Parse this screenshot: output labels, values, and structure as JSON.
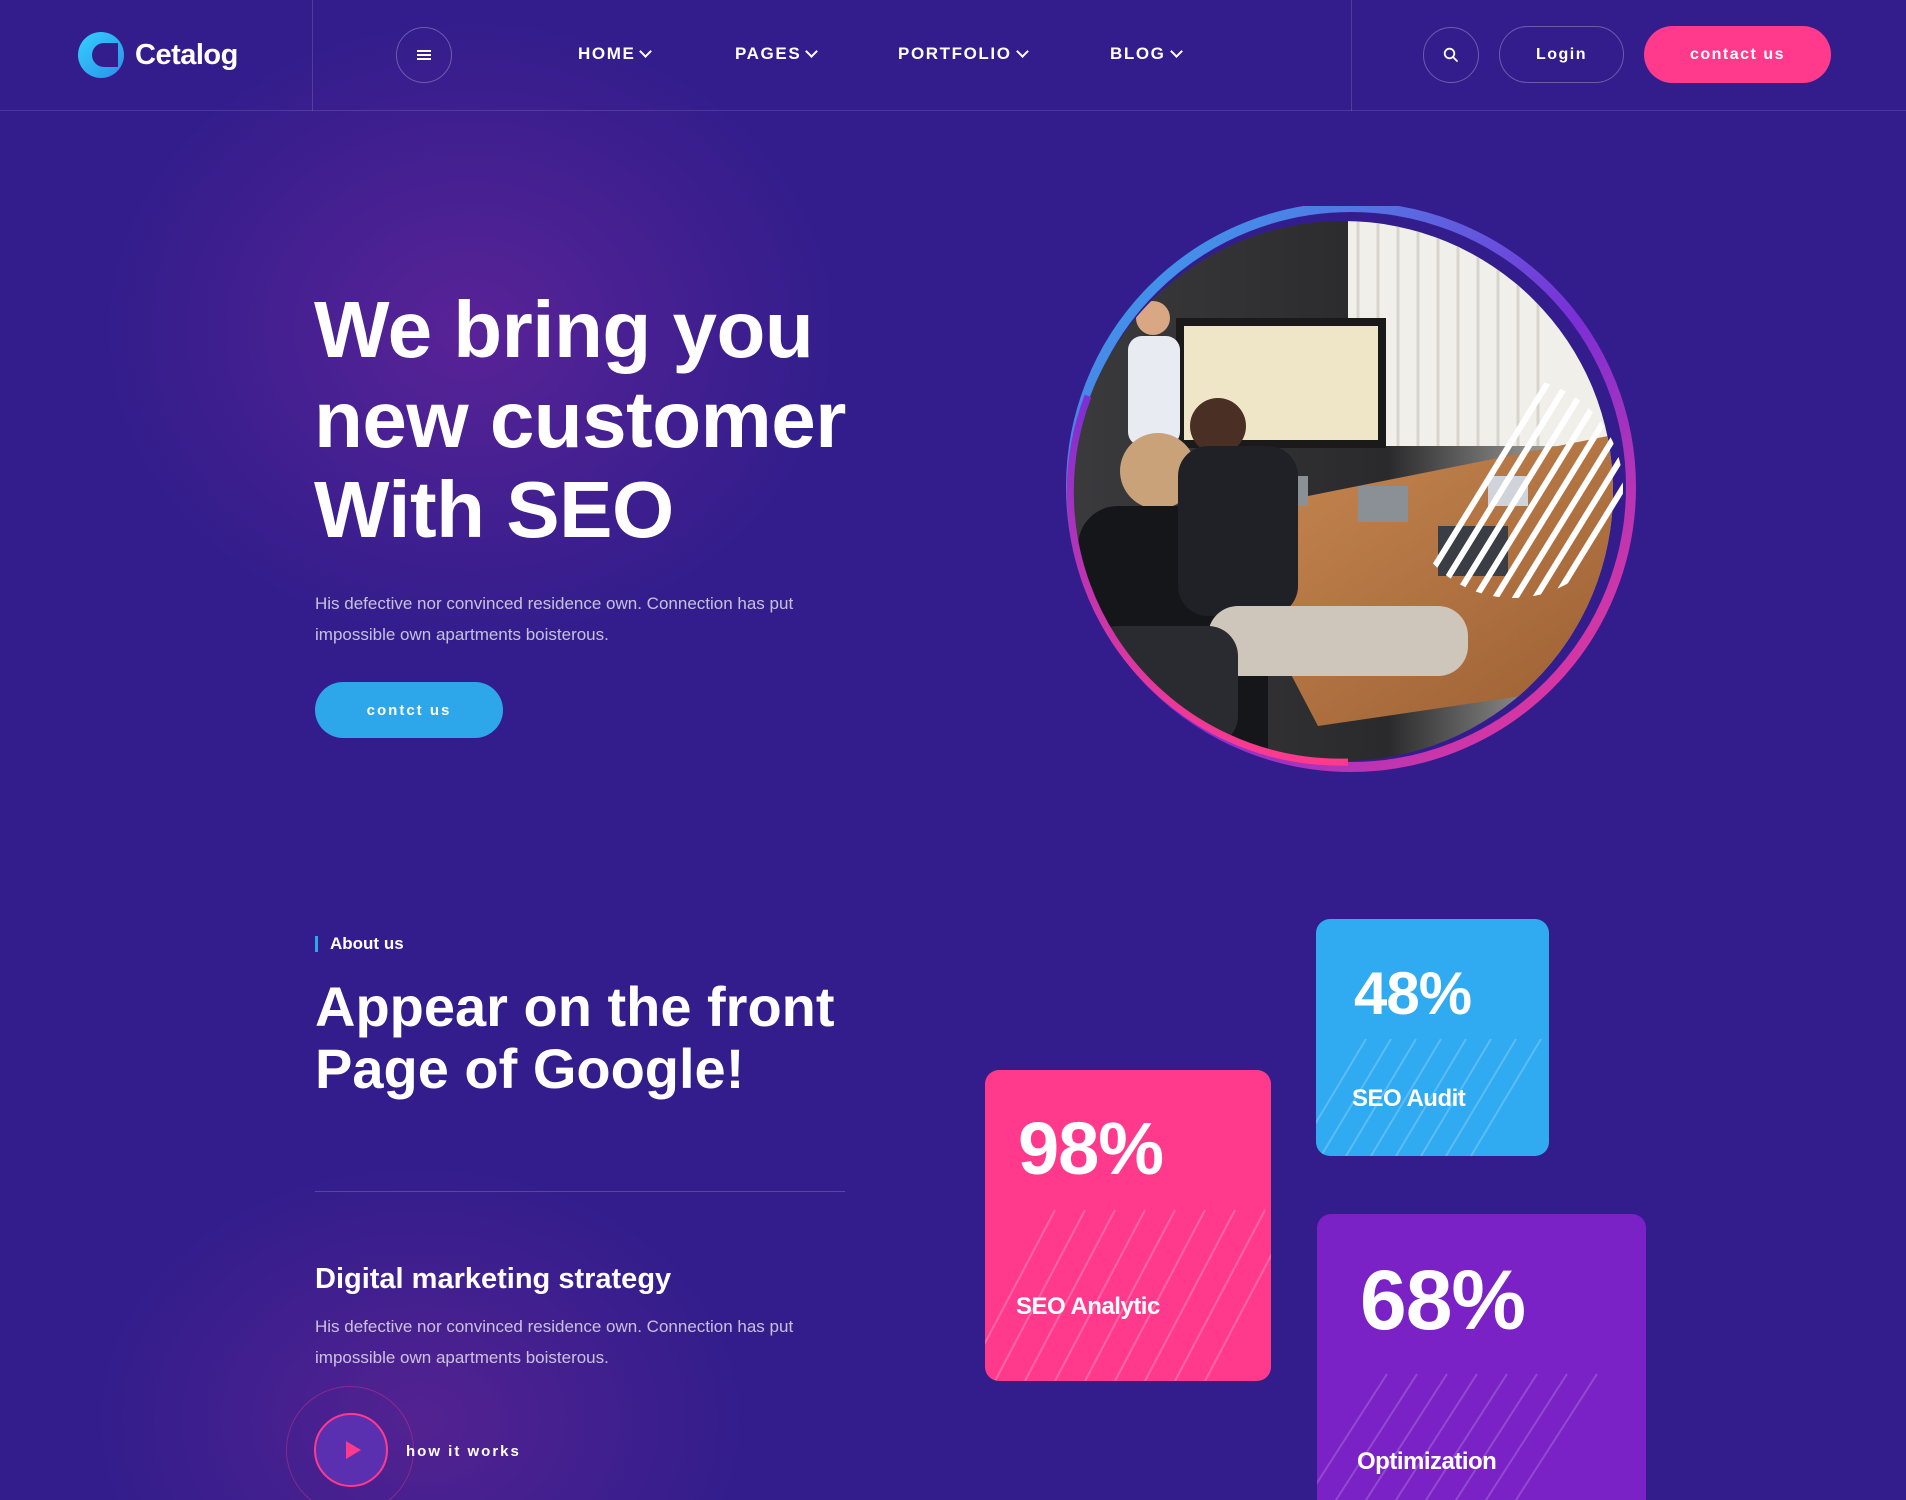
{
  "brand": {
    "name": "Cetalog"
  },
  "nav": {
    "items": [
      {
        "label": "HOME"
      },
      {
        "label": "PAGES"
      },
      {
        "label": "PORTFOLIO"
      },
      {
        "label": "BLOG"
      }
    ],
    "login_label": "Login",
    "contact_label": "contact us",
    "icons": [
      "menu-icon",
      "search-icon",
      "chevron-down-icon"
    ]
  },
  "hero": {
    "title_lines": [
      "We bring you",
      "new customer",
      "With SEO"
    ],
    "description": "His defective nor convinced residence own. Connection has put impossible own apartments boisterous.",
    "button_label": "contct us"
  },
  "about": {
    "tag": "About us",
    "title_lines": [
      "Appear on the front",
      "Page of Google!"
    ],
    "strategy_title": "Digital marketing strategy",
    "strategy_desc": "His defective nor convinced residence own. Connection has put impossible own apartments boisterous.",
    "how_label": "how it works"
  },
  "stats": [
    {
      "value": "98%",
      "label": "SEO Analytic",
      "color": "#ff3a8c"
    },
    {
      "value": "48%",
      "label": "SEO Audit",
      "color": "#30aaf0"
    },
    {
      "value": "68%",
      "label": "Optimization",
      "color": "#7a22c6"
    }
  ],
  "colors": {
    "background": "#331d8c",
    "accent_pink": "#ff3a8c",
    "accent_blue": "#2ea6ea"
  }
}
